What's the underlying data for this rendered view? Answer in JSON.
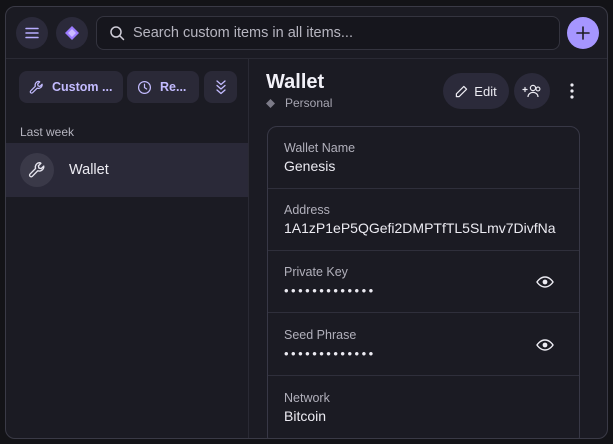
{
  "topbar": {
    "menu_icon": "hamburger-icon",
    "vault_icon": "diamond-icon",
    "search": {
      "placeholder": "Search custom items in all items...",
      "value": ""
    },
    "add_icon": "plus-icon"
  },
  "sidebar": {
    "filters": [
      {
        "label": "Custom ...",
        "icon": "wrench-icon"
      },
      {
        "label": "Re...",
        "icon": "clock-icon"
      },
      {
        "label": "",
        "icon": "chevrons-down-icon"
      }
    ],
    "section_label": "Last week",
    "items": [
      {
        "title": "Wallet",
        "icon": "wrench-icon",
        "selected": true
      }
    ]
  },
  "detail": {
    "title": "Wallet",
    "vault": "Personal",
    "edit_label": "Edit",
    "share_icon": "share-users-icon",
    "more_icon": "more-vertical-icon",
    "fields": [
      {
        "label": "Wallet Name",
        "value": "Genesis",
        "masked": false
      },
      {
        "label": "Address",
        "value": "1A1zP1eP5QGefi2DMPTfTL5SLmv7DivfNa",
        "masked": false
      },
      {
        "label": "Private Key",
        "value": "•••••••••••••",
        "masked": true
      },
      {
        "label": "Seed Phrase",
        "value": "•••••••••••••",
        "masked": true
      },
      {
        "label": "Network",
        "value": "Bitcoin",
        "masked": false
      }
    ]
  },
  "colors": {
    "accent": "#a696ff",
    "accent_text": "#c3bbff",
    "background": "#1b1b23",
    "selected_row": "#2a2938"
  }
}
